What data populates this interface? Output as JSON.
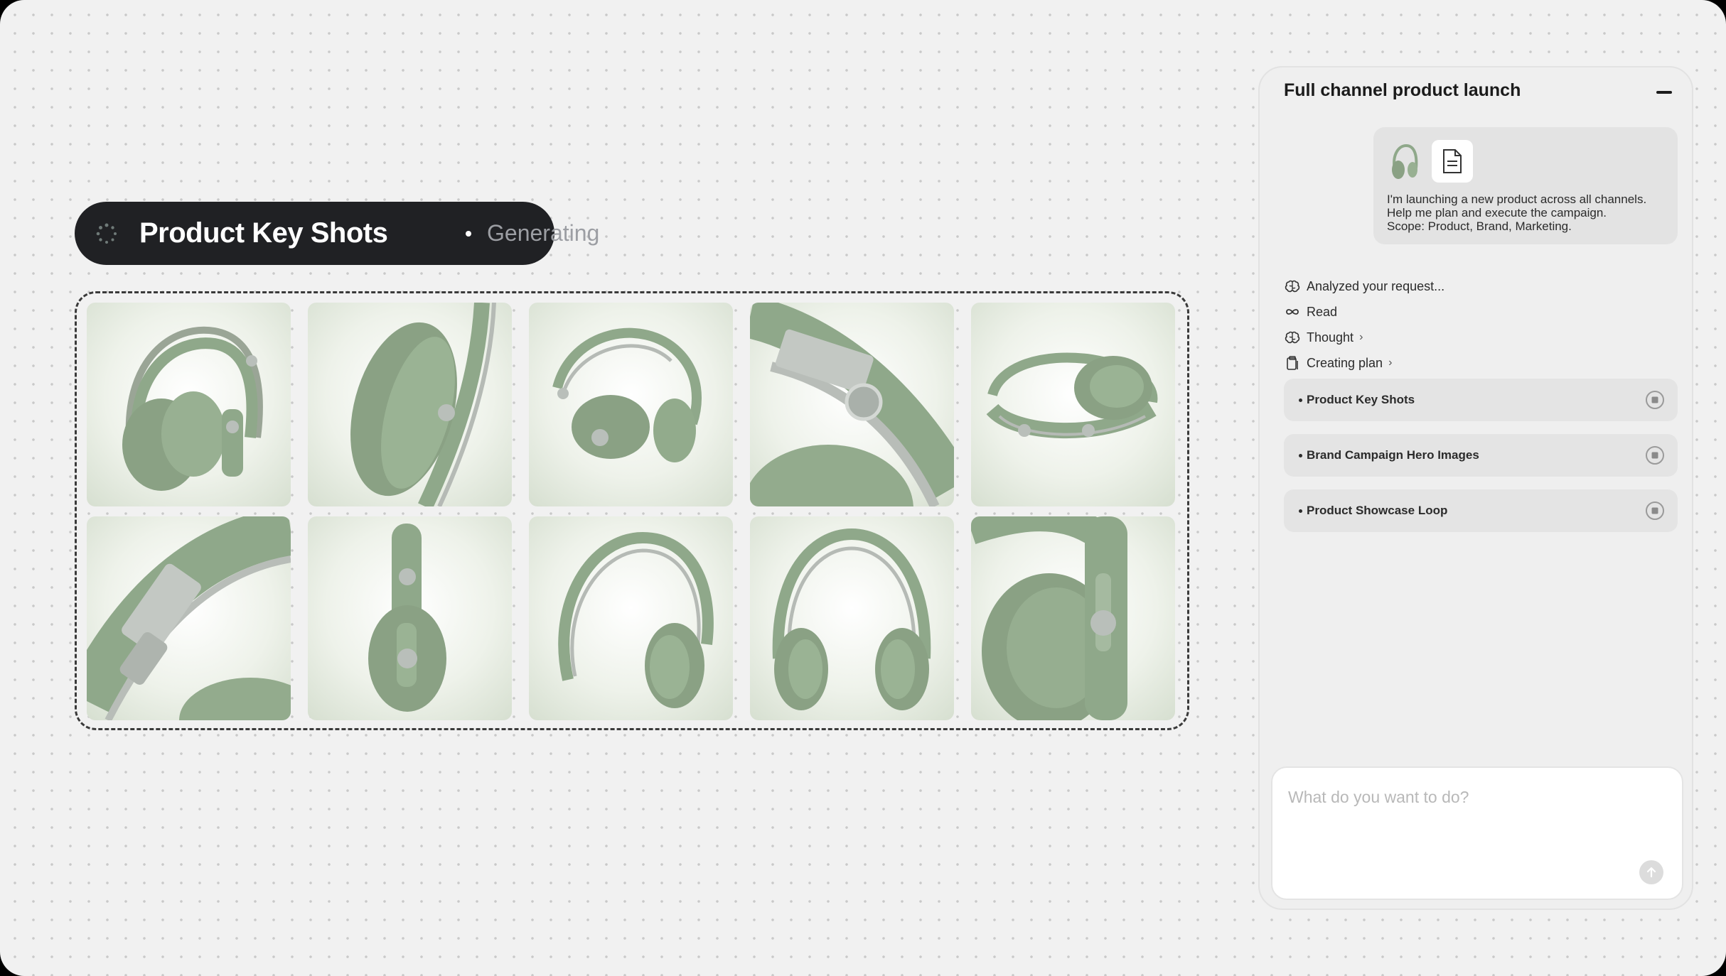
{
  "generation": {
    "title": "Product Key Shots",
    "status": "Generating"
  },
  "gallery": {
    "images": [
      {
        "icon": "headphones-three-quarter-view"
      },
      {
        "icon": "headphones-ear-cup-closeup"
      },
      {
        "icon": "headphones-angled-view"
      },
      {
        "icon": "headphones-hinge-detail"
      },
      {
        "icon": "headphones-folded-flat"
      },
      {
        "icon": "headphones-slider-detail"
      },
      {
        "icon": "headphones-side-profile"
      },
      {
        "icon": "headphones-headband-arc"
      },
      {
        "icon": "headphones-front-view"
      },
      {
        "icon": "headphones-ear-cup-macro"
      }
    ]
  },
  "panel": {
    "title": "Full channel product launch",
    "message": {
      "lines": [
        "I'm launching a new product across all channels.",
        "Help me plan and execute the campaign.",
        "Scope: Product, Brand, Marketing."
      ]
    },
    "steps": [
      {
        "label": "Analyzed your request...",
        "icon": "brain-icon",
        "chevron": ""
      },
      {
        "label": "Read",
        "icon": "infinity-icon",
        "chevron": ""
      },
      {
        "label": "Thought",
        "icon": "brain-icon",
        "chevron": "›"
      },
      {
        "label": "Creating plan",
        "icon": "clipboard-icon",
        "chevron": "›"
      }
    ],
    "tasks": [
      {
        "label": "Product Key Shots"
      },
      {
        "label": "Brand Campaign Hero Images"
      },
      {
        "label": "Product Showcase Loop"
      }
    ],
    "composer": {
      "placeholder": "What do you want to do?"
    }
  },
  "colors": {
    "pill_bg": "#202124",
    "product_green": "#8fa88a",
    "panel_bg": "#efefef"
  }
}
